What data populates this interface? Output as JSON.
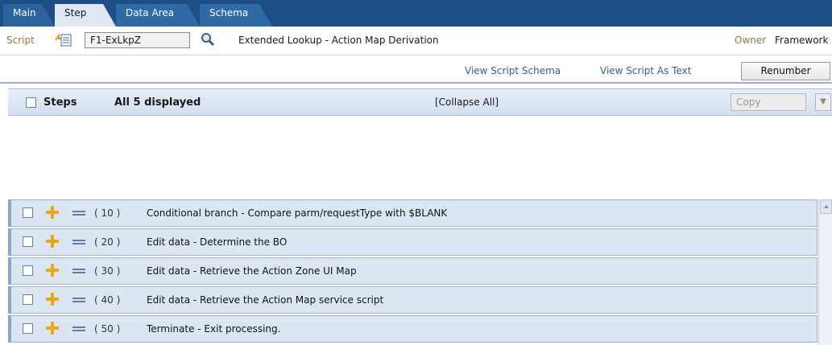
{
  "tabs": [
    {
      "label": "Main"
    },
    {
      "label": "Step"
    },
    {
      "label": "Data Area"
    },
    {
      "label": "Schema"
    }
  ],
  "header": {
    "script_label": "Script",
    "script_code": "F1-ExLkpZ",
    "description": "Extended Lookup - Action Map Derivation",
    "owner_label": "Owner",
    "owner_value": "Framework"
  },
  "links": {
    "view_schema": "View Script Schema",
    "view_text": "View Script As Text",
    "renumber": "Renumber"
  },
  "steps_panel": {
    "title": "Steps",
    "count": "All 5 displayed",
    "collapse_all": "[Collapse All]",
    "copy_label": "Copy"
  },
  "steps": [
    {
      "seq": "( 10 )",
      "text": "Conditional branch - Compare parm/requestType with $BLANK"
    },
    {
      "seq": "( 20 )",
      "text": "Edit data - Determine the BO"
    },
    {
      "seq": "( 30 )",
      "text": "Edit data - Retrieve the Action Zone UI Map"
    },
    {
      "seq": "( 40 )",
      "text": "Edit data - Retrieve the Action Map service script"
    },
    {
      "seq": "( 50 )",
      "text": "Terminate - Exit processing."
    }
  ],
  "icons": {
    "script_icon": "script-list-icon",
    "search_icon": "search-icon",
    "add_icon": "plus-icon",
    "drag_icon": "drag-handle-icon"
  },
  "colors": {
    "tabbar": "#1d4f86",
    "active_tab": "#dfe8f3",
    "link": "#2f5ea0",
    "step_row": "#dbe6f3",
    "plus": "#e8a817"
  }
}
